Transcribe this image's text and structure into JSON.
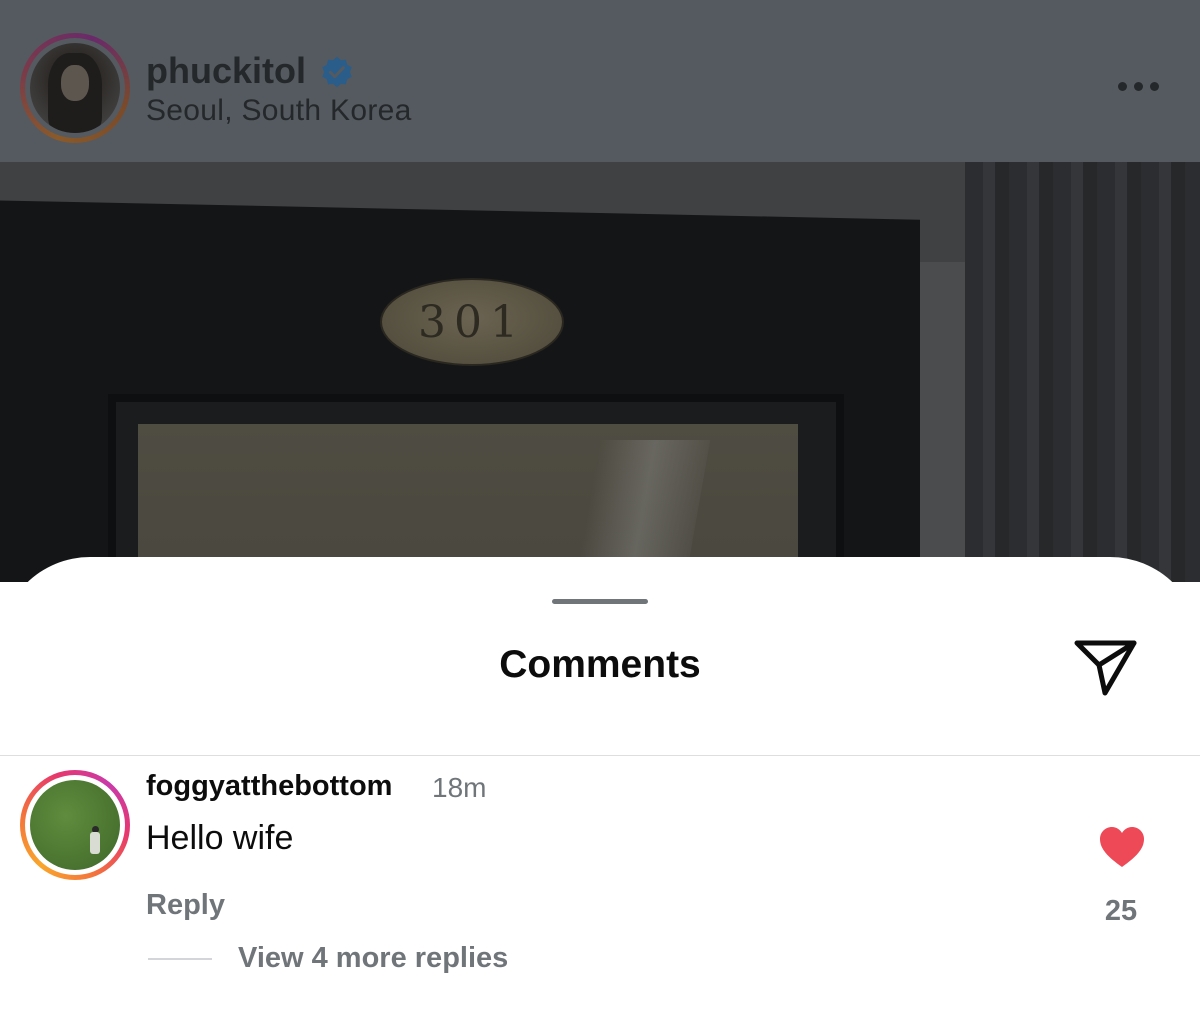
{
  "post": {
    "username": "phuckitol",
    "location": "Seoul, South Korea",
    "plaque_number": "301"
  },
  "comments_sheet": {
    "title": "Comments",
    "comments": [
      {
        "username": "foggyatthebottom",
        "time": "18m",
        "text": "Hello wife",
        "reply_label": "Reply",
        "like_count": "25",
        "liked": true,
        "view_replies_label": "View 4 more replies"
      }
    ]
  },
  "colors": {
    "like": "#ed4956",
    "verified": "#3897f0",
    "secondary_text": "#70757a"
  }
}
